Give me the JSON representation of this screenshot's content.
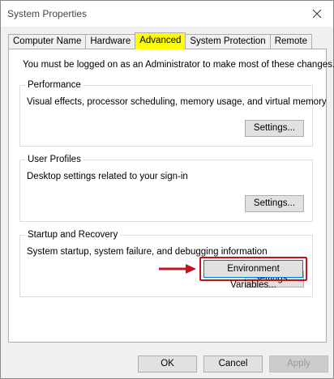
{
  "window": {
    "title": "System Properties"
  },
  "tabs": [
    {
      "label": "Computer Name",
      "active": false
    },
    {
      "label": "Hardware",
      "active": false
    },
    {
      "label": "Advanced",
      "active": true
    },
    {
      "label": "System Protection",
      "active": false
    },
    {
      "label": "Remote",
      "active": false
    }
  ],
  "advanced": {
    "admin_note": "You must be logged on as an Administrator to make most of these changes.",
    "groups": [
      {
        "title": "Performance",
        "description": "Visual effects, processor scheduling, memory usage, and virtual memory",
        "button": "Settings..."
      },
      {
        "title": "User Profiles",
        "description": "Desktop settings related to your sign-in",
        "button": "Settings..."
      },
      {
        "title": "Startup and Recovery",
        "description": "System startup, system failure, and debugging information",
        "button": "Settings..."
      }
    ],
    "env_button": "Environment Variables..."
  },
  "footer": {
    "ok": "OK",
    "cancel": "Cancel",
    "apply": "Apply",
    "apply_enabled": false
  },
  "colors": {
    "active_tab_highlight": "#ffff00",
    "annotation_red": "#c0151f",
    "focus_blue": "#0078d7"
  }
}
